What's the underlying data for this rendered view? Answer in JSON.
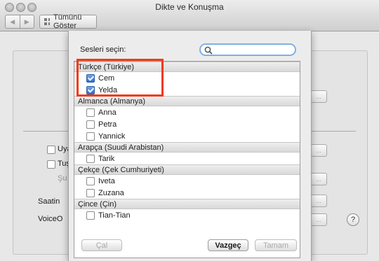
{
  "window": {
    "title": "Dikte ve Konuşma",
    "nav_back": "◀",
    "nav_forward": "▶",
    "show_all": "Tümünü Göster"
  },
  "background": {
    "checkbox1_label": "Uya",
    "checkbox2_label": "Tuş",
    "dim_text": "Şu",
    "label_saatin": "Saatin",
    "label_voice": "VoiceO",
    "ellipsis": "...",
    "help": "?"
  },
  "sheet": {
    "label": "Sesleri seçin:",
    "search": {
      "value": "",
      "placeholder": ""
    },
    "groups": [
      {
        "title": "Türkçe (Türkiye)",
        "voices": [
          {
            "name": "Cem",
            "checked": true
          },
          {
            "name": "Yelda",
            "checked": true
          }
        ]
      },
      {
        "title": "Almanca (Almanya)",
        "voices": [
          {
            "name": "Anna",
            "checked": false
          },
          {
            "name": "Petra",
            "checked": false
          },
          {
            "name": "Yannick",
            "checked": false
          }
        ]
      },
      {
        "title": "Arapça (Suudi Arabistan)",
        "voices": [
          {
            "name": "Tarik",
            "checked": false
          }
        ]
      },
      {
        "title": "Çekçe (Çek Cumhuriyeti)",
        "voices": [
          {
            "name": "Iveta",
            "checked": false
          },
          {
            "name": "Zuzana",
            "checked": false
          }
        ]
      },
      {
        "title": "Çince (Çin)",
        "voices": [
          {
            "name": "Tian-Tian",
            "checked": false
          }
        ]
      }
    ],
    "buttons": {
      "play": "Çal",
      "cancel": "Vazgeç",
      "ok": "Tamam"
    }
  }
}
